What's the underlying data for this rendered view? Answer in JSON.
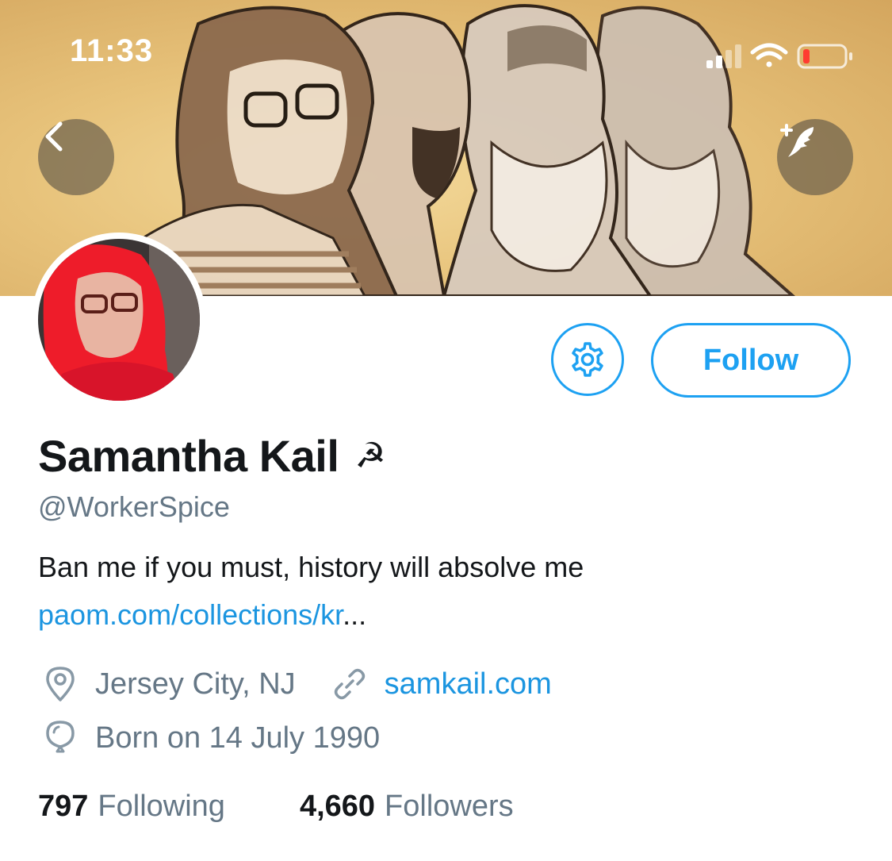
{
  "status_bar": {
    "time": "11:33",
    "signal_icon": "signal-bars-icon",
    "wifi_icon": "wifi-icon",
    "battery_icon": "battery-low-icon",
    "battery_color": "#ff3b30"
  },
  "header": {
    "back_icon": "chevron-left-icon",
    "compose_icon": "compose-tweet-icon"
  },
  "profile": {
    "display_name": "Samantha Kail",
    "name_emoji": "☭",
    "handle": "@WorkerSpice",
    "bio": "Ban me if you must, history will absolve me",
    "bio_link": "paom.com/collections/kr",
    "bio_link_ellipsis": "...",
    "location": "Jersey City, NJ",
    "website": "samkail.com",
    "birthday": "Born on 14 July 1990"
  },
  "actions": {
    "settings_icon": "gear-icon",
    "follow_label": "Follow"
  },
  "stats": {
    "following_count": "797",
    "following_label": "Following",
    "followers_count": "4,660",
    "followers_label": "Followers"
  },
  "colors": {
    "accent": "#1da1f2",
    "link": "#1b95e0",
    "secondary_text": "#657786",
    "primary_text": "#14171a"
  }
}
